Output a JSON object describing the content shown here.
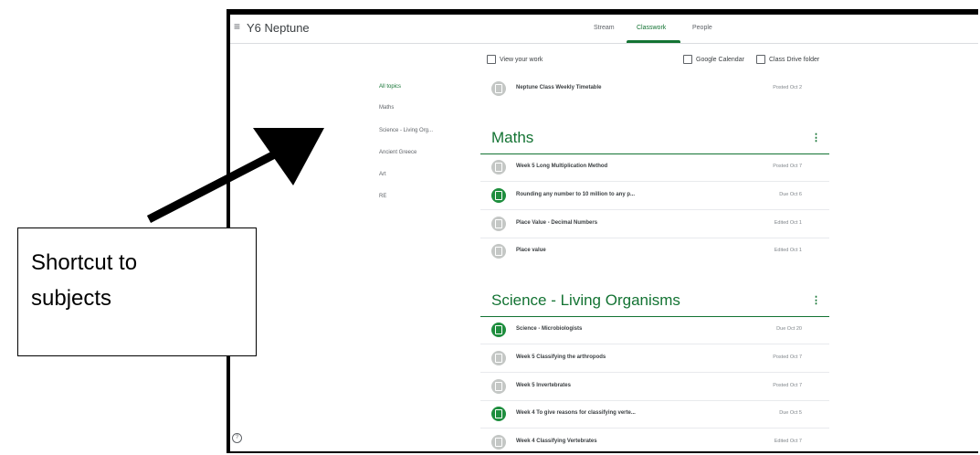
{
  "header": {
    "menu_icon": "menu-icon",
    "class_name": "Y6 Neptune",
    "tabs": [
      "Stream",
      "Classwork",
      "People"
    ],
    "active_tab": "Classwork"
  },
  "toolbar": {
    "view_work": "View your work",
    "calendar": "Google Calendar",
    "drive": "Class Drive folder"
  },
  "topics": [
    "All topics",
    "Maths",
    "Science - Living Org...",
    "Ancient Greece",
    "Art",
    "RE"
  ],
  "pinned": {
    "title": "Neptune Class Weekly Timetable",
    "date": "Posted Oct 2"
  },
  "sections": [
    {
      "title": "Maths",
      "items": [
        {
          "title": "Week 5 Long Multiplication Method",
          "date": "Posted Oct 7",
          "kind": "material"
        },
        {
          "title": "Rounding any number to 10 million to any p...",
          "date": "Due Oct 6",
          "kind": "assignment"
        },
        {
          "title": "Place Value - Decimal Numbers",
          "date": "Edited Oct 1",
          "kind": "material"
        },
        {
          "title": "Place value",
          "date": "Edited Oct 1",
          "kind": "material"
        }
      ]
    },
    {
      "title": "Science - Living Organisms",
      "items": [
        {
          "title": "Science - Microbiologists",
          "date": "Due Oct 20",
          "kind": "assignment"
        },
        {
          "title": "Week 5 Classifying the arthropods",
          "date": "Posted Oct 7",
          "kind": "material"
        },
        {
          "title": "Week 5 Invertebrates",
          "date": "Posted Oct 7",
          "kind": "material"
        },
        {
          "title": "Week 4 To give reasons for classifying verte...",
          "date": "Due Oct 5",
          "kind": "assignment"
        },
        {
          "title": "Week 4 Classifying Vertebrates",
          "date": "Edited Oct 7",
          "kind": "material"
        }
      ]
    }
  ],
  "annotation": {
    "text_line1": "Shortcut to",
    "text_line2": "subjects",
    "arrow_color": "#000000"
  },
  "colors": {
    "accent": "#137333",
    "assignment_icon": "#1e8e3e",
    "material_icon": "#c4c7c5"
  }
}
